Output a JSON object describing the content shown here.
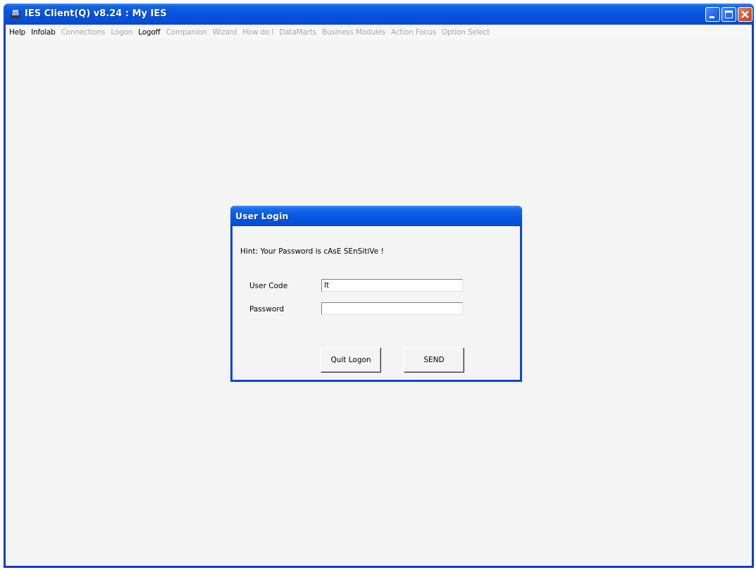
{
  "window": {
    "title": "IES Client(Q) v8.24 : My IES"
  },
  "menu": [
    {
      "label": "Help",
      "enabled": true
    },
    {
      "label": "Infolab",
      "enabled": true
    },
    {
      "label": "Connections",
      "enabled": false
    },
    {
      "label": "Logon",
      "enabled": false
    },
    {
      "label": "Logoff",
      "enabled": true
    },
    {
      "label": "Companion",
      "enabled": false
    },
    {
      "label": "Wizard",
      "enabled": false
    },
    {
      "label": "How do I",
      "enabled": false
    },
    {
      "label": "DataMarts",
      "enabled": false
    },
    {
      "label": "Business Modules",
      "enabled": false
    },
    {
      "label": "Action Focus",
      "enabled": false
    },
    {
      "label": "Option Select",
      "enabled": false
    }
  ],
  "dialog": {
    "title": "User Login",
    "hint": "Hint: Your Password is cAsE SEnSitiVe !",
    "user_code_label": "User Code",
    "user_code_value": "lt",
    "password_label": "Password",
    "password_value": "",
    "quit_button": "Quit Logon",
    "send_button": "SEND"
  },
  "colors": {
    "titlebar_blue": "#0551dc",
    "close_red": "#d6532d",
    "client_bg": "#f4f4f4",
    "menu_disabled": "#a8a8a8"
  }
}
